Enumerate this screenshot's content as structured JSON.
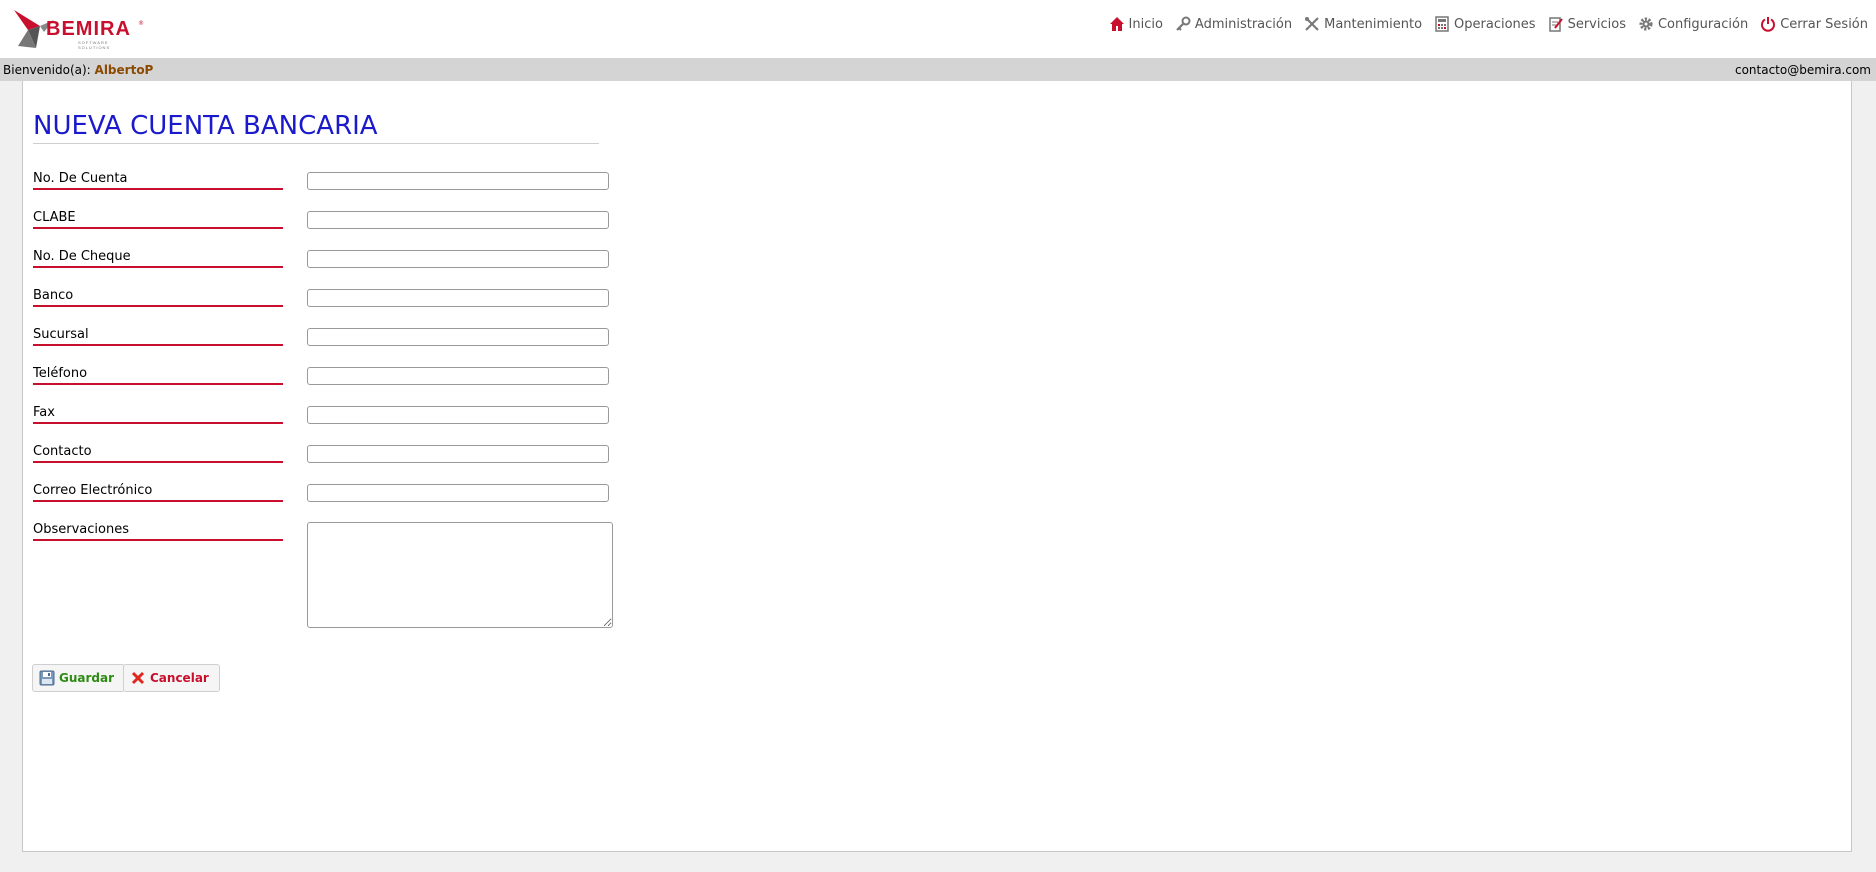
{
  "logo": {
    "name": "BEMIRA",
    "sub": "SOFTWARE SOLUTIONS",
    "mark": "®"
  },
  "nav": {
    "inicio": "Inicio",
    "administracion": "Administración",
    "mantenimiento": "Mantenimiento",
    "operaciones": "Operaciones",
    "servicios": "Servicios",
    "configuracion": "Configuración",
    "cerrar": "Cerrar Sesión"
  },
  "subbar": {
    "welcome": "Bienvenido(a):",
    "username": "AlbertoP",
    "email": "contacto@bemira.com"
  },
  "form": {
    "title": "NUEVA CUENTA BANCARIA",
    "fields": {
      "cuenta": {
        "label": "No. De Cuenta",
        "value": ""
      },
      "clabe": {
        "label": "CLABE",
        "value": ""
      },
      "cheque": {
        "label": "No. De Cheque",
        "value": ""
      },
      "banco": {
        "label": "Banco",
        "value": ""
      },
      "sucursal": {
        "label": "Sucursal",
        "value": ""
      },
      "telefono": {
        "label": "Teléfono",
        "value": ""
      },
      "fax": {
        "label": "Fax",
        "value": ""
      },
      "contacto": {
        "label": "Contacto",
        "value": ""
      },
      "correo": {
        "label": "Correo Electrónico",
        "value": ""
      },
      "observaciones": {
        "label": "Observaciones",
        "value": ""
      }
    }
  },
  "buttons": {
    "guardar": "Guardar",
    "cancelar": "Cancelar"
  },
  "colors": {
    "title": "#1a1acc",
    "label_underline": "#c8102e",
    "guardar_text": "#2e8b14",
    "cancelar_text": "#c8102e",
    "username": "#8b4a00"
  }
}
